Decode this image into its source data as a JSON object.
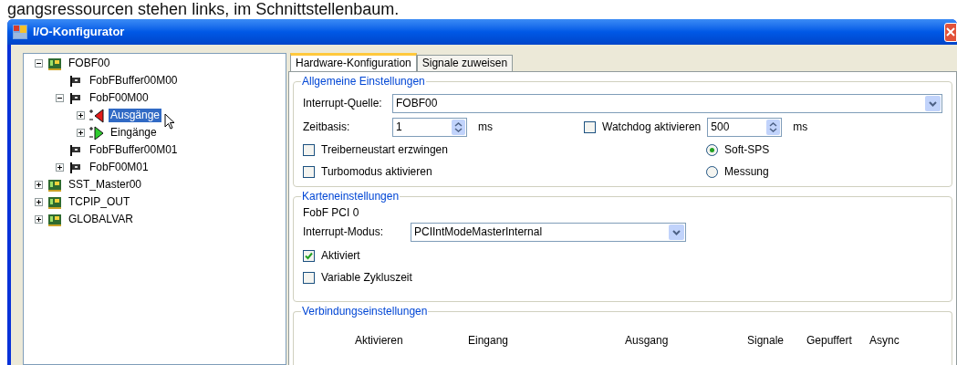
{
  "caption": "gangsressourcen stehen links, im Schnittstellenbaum.",
  "window": {
    "title": "I/O-Konfigurator"
  },
  "tree": [
    {
      "label": "FOBF00",
      "kind": "device",
      "expanded": true,
      "selected": false,
      "children": [
        {
          "label": "FobFBuffer00M00",
          "kind": "module",
          "selected": false
        },
        {
          "label": "FobF00M00",
          "kind": "module",
          "expanded": true,
          "selected": false,
          "children": [
            {
              "label": "Ausgänge",
              "kind": "output",
              "expanded": false,
              "selected": true
            },
            {
              "label": "Eingänge",
              "kind": "input",
              "expanded": false,
              "selected": false
            }
          ]
        },
        {
          "label": "FobFBuffer00M01",
          "kind": "module",
          "selected": false
        },
        {
          "label": "FobF00M01",
          "kind": "module",
          "expanded": false,
          "selected": false
        }
      ]
    },
    {
      "label": "SST_Master00",
      "kind": "device",
      "expanded": false,
      "selected": false
    },
    {
      "label": "TCPIP_OUT",
      "kind": "device",
      "expanded": false,
      "selected": false
    },
    {
      "label": "GLOBALVAR",
      "kind": "device",
      "expanded": false,
      "selected": false
    }
  ],
  "tabs": [
    {
      "label": "Hardware-Konfiguration",
      "selected": true
    },
    {
      "label": "Signale zuweisen",
      "selected": false
    }
  ],
  "general": {
    "title": "Allgemeine Einstellungen",
    "interrupt_source": {
      "label": "Interrupt-Quelle:",
      "value": "FOBF00"
    },
    "time_base": {
      "label": "Zeitbasis:",
      "value": "1",
      "unit": "ms"
    },
    "watchdog": {
      "label": "Watchdog aktivieren",
      "checked": false,
      "value": "500",
      "unit": "ms"
    },
    "options": [
      {
        "label": "Treiberneustart erzwingen",
        "checked": false
      },
      {
        "label": "Turbomodus aktivieren",
        "checked": false
      }
    ],
    "modes": [
      {
        "label": "Soft-SPS",
        "selected": true
      },
      {
        "label": "Messung",
        "selected": false
      }
    ]
  },
  "card": {
    "title": "Karteneinstellungen",
    "name": "FobF PCI 0",
    "interrupt_mode": {
      "label": "Interrupt-Modus:",
      "value": "PCIIntModeMasterInternal"
    },
    "options": [
      {
        "label": "Aktiviert",
        "checked": true
      },
      {
        "label": "Variable Zykluszeit",
        "checked": false
      }
    ]
  },
  "connection": {
    "title": "Verbindungseinstellungen",
    "columns": [
      "Aktivieren",
      "Eingang",
      "Ausgang",
      "Signale",
      "Gepuffert",
      "Async"
    ]
  }
}
